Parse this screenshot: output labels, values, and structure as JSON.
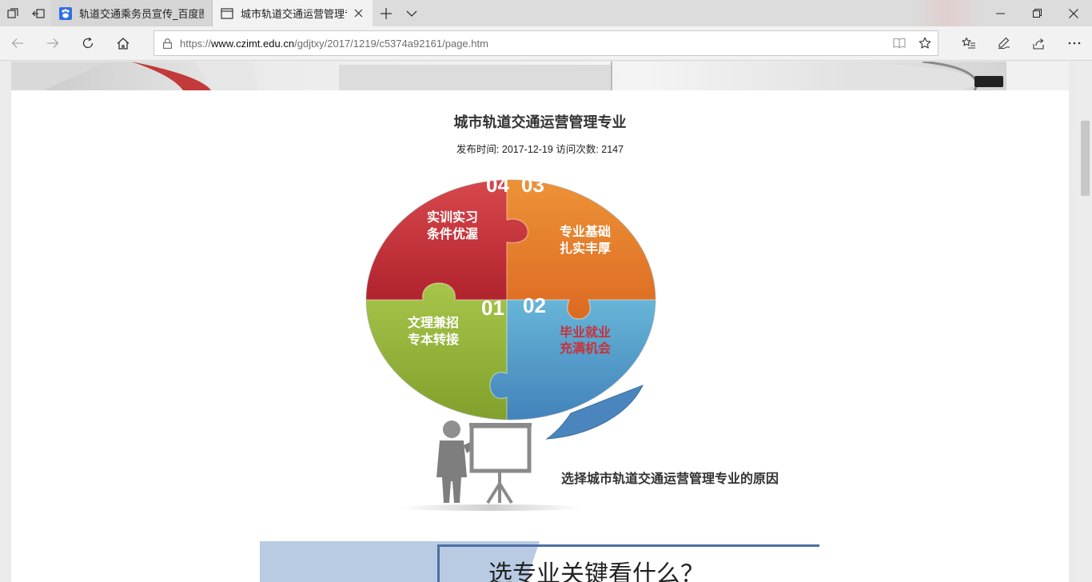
{
  "browser": {
    "tabs": [
      {
        "label": "轨道交通乘务员宣传_百度图",
        "active": false,
        "favicon": "baidu-paw-icon"
      },
      {
        "label": "城市轨道交通运营管理专",
        "active": true,
        "favicon": "page-icon"
      }
    ],
    "url": {
      "scheme": "https://",
      "domain": "www.czimt.edu.cn",
      "path": "/gdjtxy/2017/1219/c5374a92161/page.htm"
    },
    "accent": "#f2f2f2"
  },
  "article": {
    "title": "城市轨道交通运营管理专业",
    "meta_label_date": "发布时间:",
    "date": "2017-12-19",
    "meta_label_views": "访问次数:",
    "views": "2147"
  },
  "puzzle": {
    "pieces": [
      {
        "number": "04",
        "line1": "实训实习",
        "line2": "条件优渥",
        "color": "#c0323a"
      },
      {
        "number": "03",
        "line1": "专业基础",
        "line2": "扎实丰厚",
        "color": "#e0722e"
      },
      {
        "number": "01",
        "line1": "文理兼招",
        "line2": "专本转接",
        "color": "#8db33a"
      },
      {
        "number": "02",
        "line1": "毕业就业",
        "line2": "充满机会",
        "color": "#5aa8cf"
      }
    ],
    "caption": "选择城市轨道交通运营管理专业的原因"
  },
  "next_banner": {
    "heading": "选专业关键看什么？"
  }
}
